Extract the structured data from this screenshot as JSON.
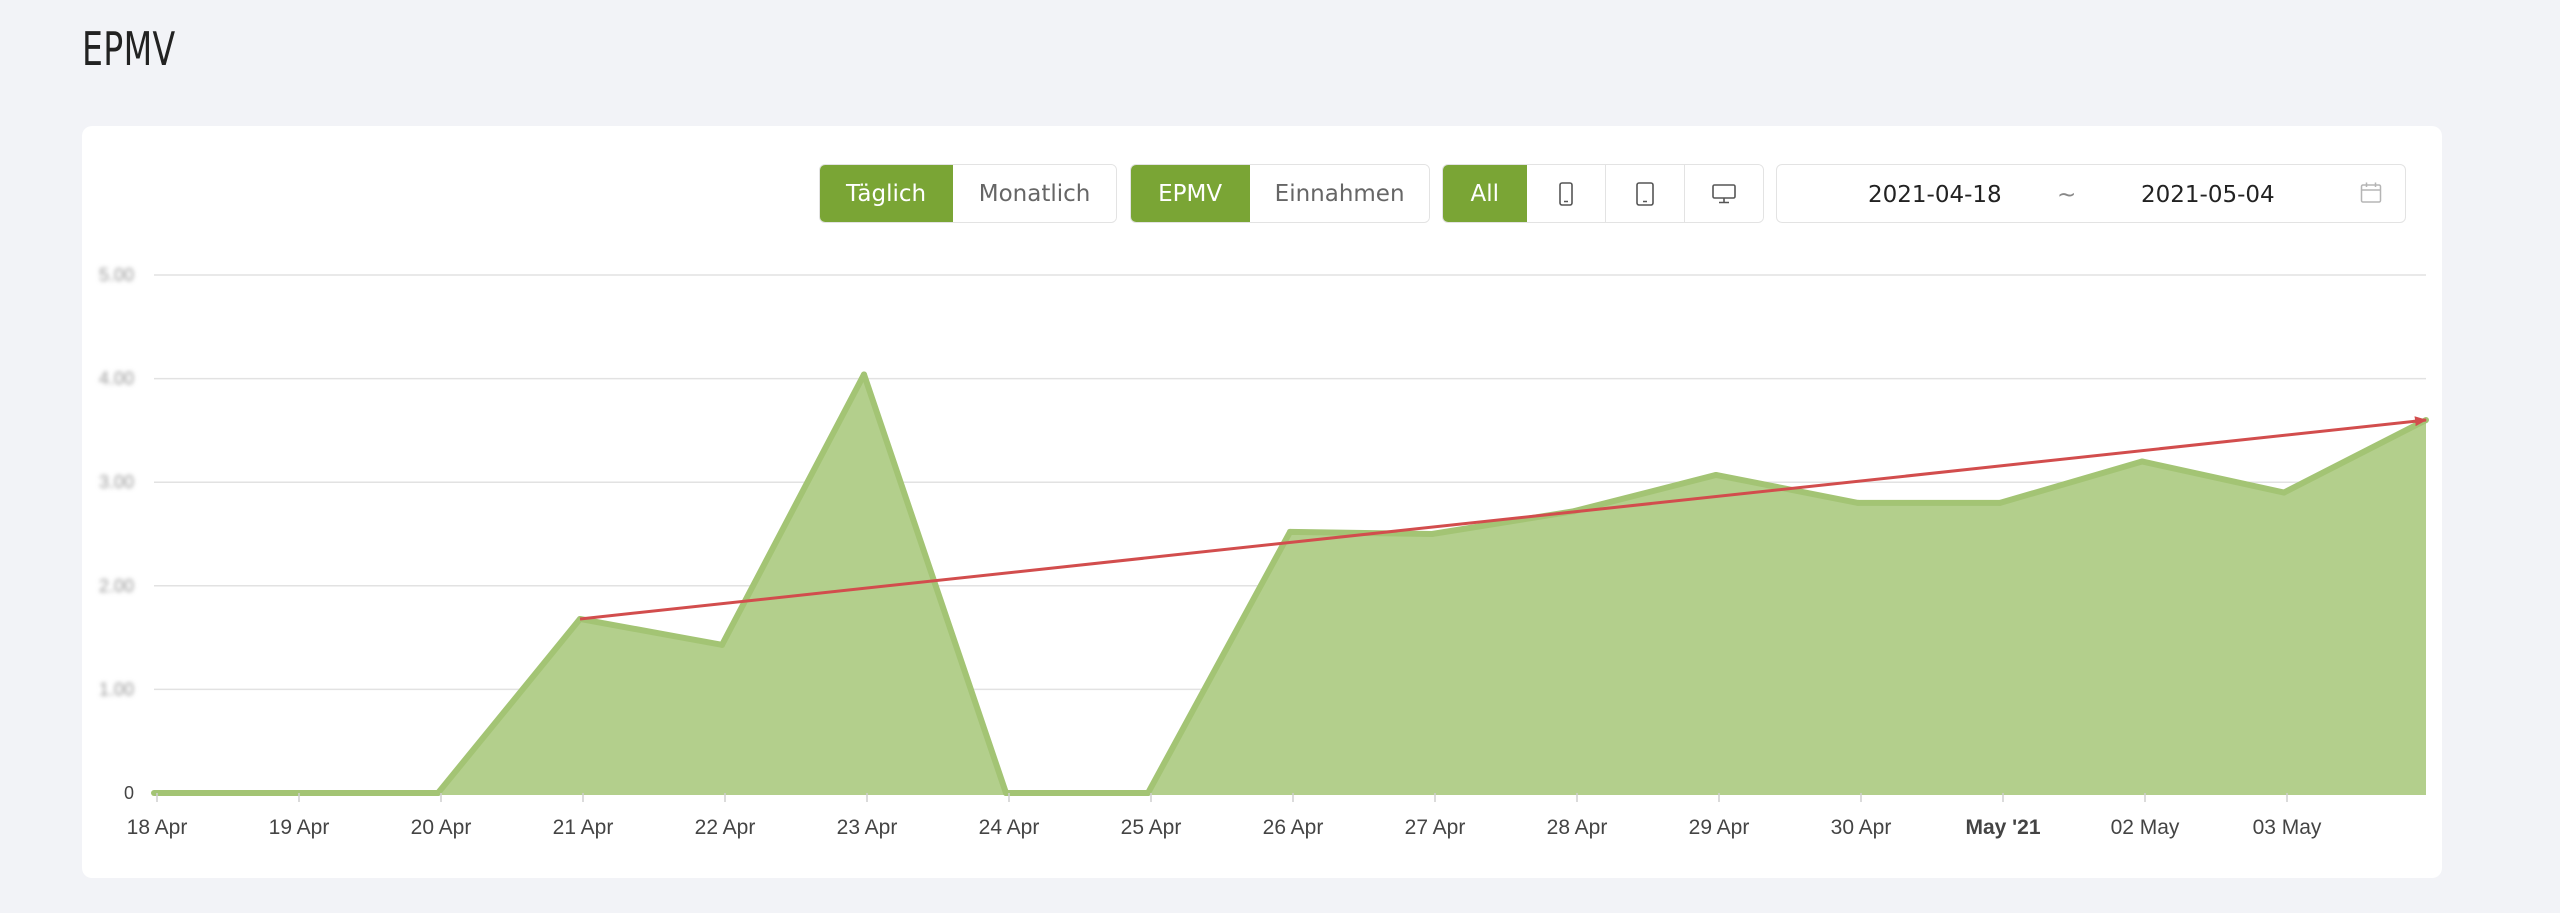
{
  "page": {
    "title": "EPMV"
  },
  "toolbar": {
    "period": {
      "daily": "Täglich",
      "monthly": "Monatlich",
      "active": "daily"
    },
    "metric": {
      "epmv": "EPMV",
      "revenue": "Einnahmen",
      "active": "epmv"
    },
    "device": {
      "all": "All",
      "active": "all",
      "icons": [
        "mobile-phone-icon",
        "tablet-icon",
        "desktop-monitor-icon"
      ]
    },
    "date_range": {
      "start": "2021-04-18",
      "separator": "~",
      "end": "2021-05-04",
      "icon": "calendar-icon"
    }
  },
  "colors": {
    "accent": "#7aa535",
    "area_fill": "#b3cf8c",
    "area_stroke": "#a3c474",
    "trend_line": "#d24d4d",
    "grid": "#e2e2e2"
  },
  "chart_data": {
    "type": "area",
    "y_axis": {
      "ticks": [
        "0",
        "1.00",
        "2.00",
        "3.00",
        "4.00",
        "5.00"
      ],
      "obscured_ticks": [
        "1.00",
        "2.00",
        "3.00",
        "4.00",
        "5.00"
      ],
      "ylim": [
        0,
        5
      ]
    },
    "x_labels": [
      "18 Apr",
      "19 Apr",
      "20 Apr",
      "21 Apr",
      "22 Apr",
      "23 Apr",
      "24 Apr",
      "25 Apr",
      "26 Apr",
      "27 Apr",
      "28 Apr",
      "29 Apr",
      "30 Apr",
      "May '21",
      "02 May",
      "03 May"
    ],
    "x_bold_labels": [
      "May '21"
    ],
    "grid": true,
    "legend": "none",
    "series": [
      {
        "x": [
          "2021-04-18",
          "2021-04-19",
          "2021-04-20",
          "2021-04-21",
          "2021-04-22",
          "2021-04-23",
          "2021-04-24",
          "2021-04-25",
          "2021-04-26",
          "2021-04-27",
          "2021-04-28",
          "2021-04-29",
          "2021-04-30",
          "2021-05-01",
          "2021-05-02",
          "2021-05-03",
          "2021-05-04"
        ],
        "values": [
          0,
          0,
          0,
          1.68,
          1.43,
          4.04,
          0,
          0,
          2.52,
          2.5,
          2.72,
          3.07,
          2.8,
          2.8,
          3.2,
          2.9,
          3.6
        ]
      }
    ],
    "annotations": [
      {
        "type": "trend-arrow",
        "from": {
          "x": "2021-04-21",
          "y": 1.68
        },
        "to": {
          "x": "2021-05-04",
          "y": 3.6
        }
      }
    ]
  }
}
